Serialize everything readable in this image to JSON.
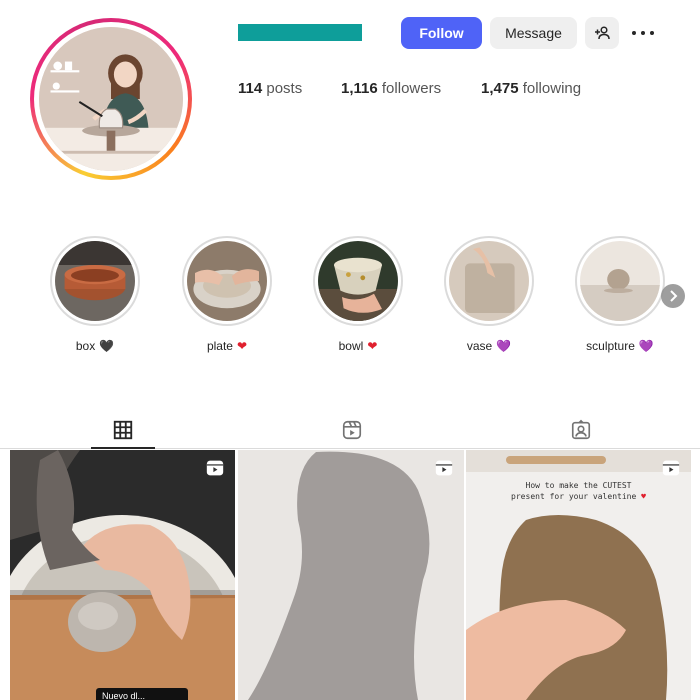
{
  "profile": {
    "avatar_icon": "profile-illustration-potter-at-wheel"
  },
  "actions": {
    "follow_label": "Follow",
    "message_label": "Message",
    "suggest_icon": "add-person-icon",
    "more_icon": "more-horizontal-icon"
  },
  "stats": {
    "posts_count": "114",
    "posts_label": "posts",
    "followers_count": "1,116",
    "followers_label": "followers",
    "following_count": "1,475",
    "following_label": "following"
  },
  "highlights": [
    {
      "label": "box",
      "heart": "🖤",
      "heart_color": "#262626"
    },
    {
      "label": "plate",
      "heart": "❤",
      "heart_color": "#e0202e"
    },
    {
      "label": "bowl",
      "heart": "❤",
      "heart_color": "#e0202e"
    },
    {
      "label": "vase",
      "heart": "💜",
      "heart_color": "#8a5cd6"
    },
    {
      "label": "sculpture",
      "heart": "💜",
      "heart_color": "#8a5cd6"
    }
  ],
  "highlights_next_icon": "chevron-right-icon",
  "tabs": [
    {
      "name": "posts",
      "icon": "grid-icon",
      "active": true
    },
    {
      "name": "reels",
      "icon": "reels-icon",
      "active": false
    },
    {
      "name": "tagged",
      "icon": "tagged-icon",
      "active": false
    }
  ],
  "posts": [
    {
      "type": "reel",
      "caption_tag": "Nuevo dl..."
    },
    {
      "type": "reel"
    },
    {
      "type": "reel",
      "overlay_line1": "How to make the CUTEST",
      "overlay_line2": "present for your valentine"
    }
  ],
  "colors": {
    "accent": "#4f63f7",
    "username_bar": "#0e9e9a",
    "border": "#dbdbdb"
  }
}
